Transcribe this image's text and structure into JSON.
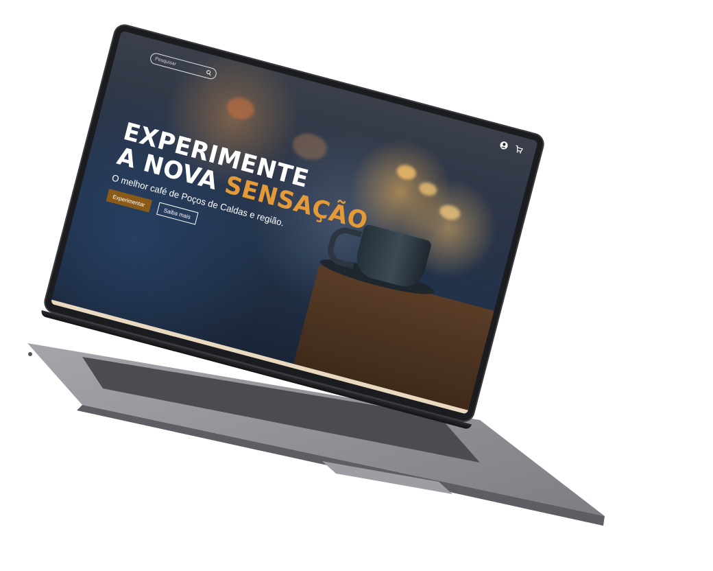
{
  "search": {
    "placeholder": "Pesquisar"
  },
  "header": {
    "account_icon": "user-circle-icon",
    "cart_icon": "cart-icon"
  },
  "hero": {
    "title_line1": "EXPERIMENTE",
    "title_line2_a": "A NOVA",
    "title_line2_b": "SENSAÇÃO",
    "subtitle": "O melhor café de Poços de Caldas e região.",
    "primary_button": "Experimentar",
    "secondary_button": "Saiba mais"
  },
  "colors": {
    "accent": "#e49a36",
    "primary_button_bg": "#8a5a18",
    "laptop_body": "#8e9096"
  }
}
